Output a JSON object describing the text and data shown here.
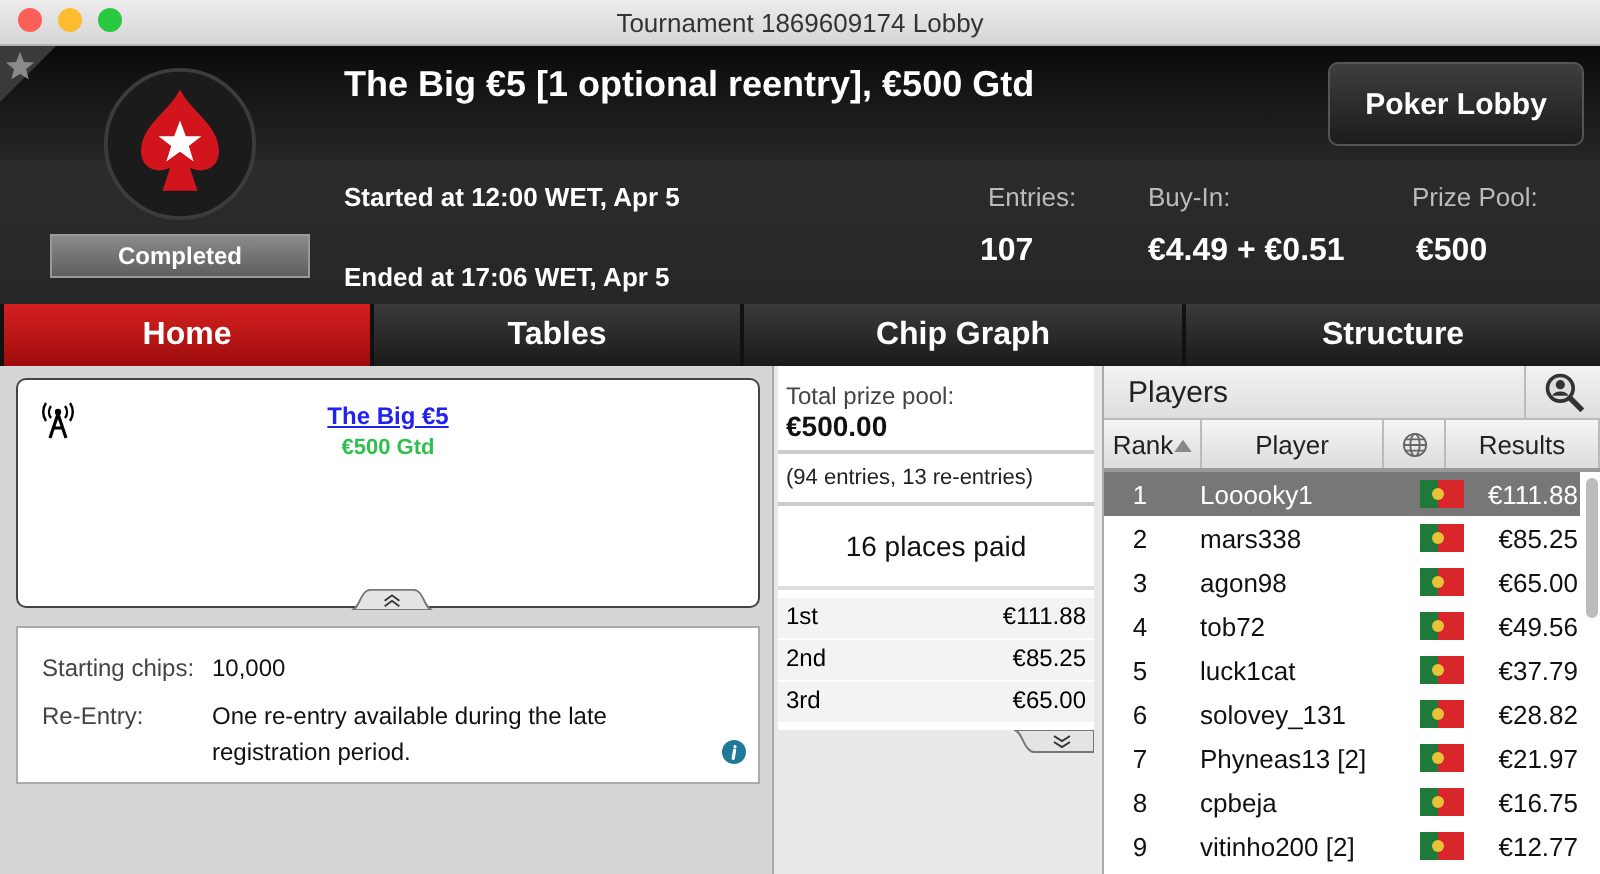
{
  "window": {
    "title": "Tournament 1869609174 Lobby"
  },
  "header": {
    "title": "The Big €5 [1 optional reentry], €500 Gtd",
    "status": "Completed",
    "started": "Started at 12:00 WET, Apr 5",
    "ended": "Ended at 17:06 WET, Apr 5",
    "lobby_button": "Poker Lobby",
    "stats": [
      {
        "label": "Entries:",
        "value": "107"
      },
      {
        "label": "Buy-In:",
        "value": "€4.49 + €0.51"
      },
      {
        "label": "Prize Pool:",
        "value": "€500"
      }
    ]
  },
  "tabs": [
    {
      "label": "Home",
      "selected": true
    },
    {
      "label": "Tables",
      "selected": false
    },
    {
      "label": "Chip Graph",
      "selected": false
    },
    {
      "label": "Structure",
      "selected": false
    }
  ],
  "event": {
    "link": "The Big €5",
    "guarantee": "€500 Gtd"
  },
  "details": [
    {
      "label": "Starting chips:",
      "value": "10,000",
      "info": false
    },
    {
      "label": "Re-Entry:",
      "value": "One re-entry available during the late registration period.",
      "info": true
    }
  ],
  "prizes": {
    "total_label": "Total prize pool:",
    "total_value": "€500.00",
    "entries_note": "(94 entries, 13 re-entries)",
    "places_paid": "16 places paid",
    "payouts": [
      {
        "place": "1st",
        "amount": "€111.88"
      },
      {
        "place": "2nd",
        "amount": "€85.25"
      },
      {
        "place": "3rd",
        "amount": "€65.00"
      }
    ]
  },
  "players": {
    "title": "Players",
    "columns": [
      "Rank",
      "Player",
      "Results"
    ],
    "rows": [
      {
        "rank": "1",
        "player": "Looooky1",
        "result": "€111.88",
        "selected": true
      },
      {
        "rank": "2",
        "player": "mars338",
        "result": "€85.25",
        "selected": false
      },
      {
        "rank": "3",
        "player": "agon98",
        "result": "€65.00",
        "selected": false
      },
      {
        "rank": "4",
        "player": "tob72",
        "result": "€49.56",
        "selected": false
      },
      {
        "rank": "5",
        "player": "luck1cat",
        "result": "€37.79",
        "selected": false
      },
      {
        "rank": "6",
        "player": "solovey_131",
        "result": "€28.82",
        "selected": false
      },
      {
        "rank": "7",
        "player": "Phyneas13 [2]",
        "result": "€21.97",
        "selected": false
      },
      {
        "rank": "8",
        "player": "cpbeja",
        "result": "€16.75",
        "selected": false
      },
      {
        "rank": "9",
        "player": "vitinho200 [2]",
        "result": "€12.77",
        "selected": false
      }
    ]
  }
}
